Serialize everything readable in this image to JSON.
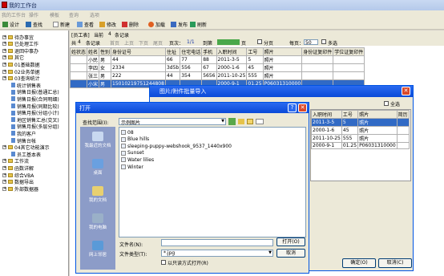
{
  "app": {
    "title": "我的工作台"
  },
  "menu": [
    "我的工作台",
    "操作",
    "模板",
    "查询",
    "选项"
  ],
  "toolbar": {
    "design": "设计",
    "search": "查找",
    "new": "新建",
    "view": "查看",
    "modify": "修改",
    "delete": "删除",
    "load": "加载",
    "publish": "发布",
    "refresh": "刷新"
  },
  "sidebar": {
    "items": [
      {
        "label": "待办事宜",
        "type": "folder"
      },
      {
        "label": "已处理工作",
        "type": "folder"
      },
      {
        "label": "退回中事办",
        "type": "folder"
      },
      {
        "label": "其它",
        "type": "folder"
      },
      {
        "label": "01基础数据",
        "type": "folder"
      },
      {
        "label": "02业务单据",
        "type": "folder"
      },
      {
        "label": "03查询统计",
        "type": "folder"
      },
      {
        "label": "统计销售表",
        "type": "leaf"
      },
      {
        "label": "销售日报(普通汇总)",
        "type": "leaf"
      },
      {
        "label": "销售日报(合同明细)",
        "type": "leaf"
      },
      {
        "label": "销售月报(同期比较)",
        "type": "leaf"
      },
      {
        "label": "销售月报(分组小计)",
        "type": "leaf"
      },
      {
        "label": "地区销售汇总(交叉)",
        "type": "leaf"
      },
      {
        "label": "销售月报(多层分组)",
        "type": "leaf"
      },
      {
        "label": "我的客户",
        "type": "leaf"
      },
      {
        "label": "销售台帐",
        "type": "leaf"
      },
      {
        "label": "04其它功能演示",
        "type": "folder"
      },
      {
        "label": "员工基本表",
        "type": "leaf"
      },
      {
        "label": "工作流",
        "type": "folder"
      },
      {
        "label": "函数详解",
        "type": "folder"
      },
      {
        "label": "综合VBA",
        "type": "folder"
      },
      {
        "label": "数据导出",
        "type": "folder"
      },
      {
        "label": "外部数据器",
        "type": "folder"
      }
    ]
  },
  "filter": {
    "employee": "[员工表]",
    "match": "当前",
    "count": "4",
    "records": "条记录"
  },
  "pager": {
    "total_label": "共",
    "total": "4",
    "unit": "条记录",
    "first": "首页",
    "prev": "上页",
    "next": "下页",
    "last": "尾页",
    "pages_label": "页次：",
    "pages": "1/1",
    "goto": "到第",
    "page_unit": "页",
    "paging": "分页",
    "per_page_label": "每页：",
    "per_page": "50",
    "multi": "多选"
  },
  "grid": {
    "columns": [
      "姓状态",
      "姓名",
      "性别",
      "身份证号",
      "住址",
      "住宅电话",
      "手机",
      "入职时间",
      "工号",
      "照片",
      "身份证复印件",
      "学位证复印件"
    ],
    "rows": [
      [
        "",
        "小民",
        "男",
        "44",
        "66",
        "77",
        "88",
        "2011-3-5",
        "5",
        "照片",
        "",
        ""
      ],
      [
        "",
        "李四",
        "女",
        "2334",
        "3d5b",
        "556",
        "67",
        "2000-1-6",
        "45",
        "照片",
        "",
        ""
      ],
      [
        "",
        "张三",
        "男",
        "222",
        "44",
        "354",
        "5656",
        "2011-10-25",
        "555",
        "照片",
        "",
        ""
      ],
      [
        "",
        "小宋",
        "男",
        "15010219751244808",
        "",
        "",
        "",
        "2000-9-1",
        "01.25",
        "P06031310000",
        "",
        ""
      ]
    ]
  },
  "import_window": {
    "title": "图片/附件批量导入",
    "select_all": "全选",
    "columns": [
      "入职时间",
      "工号",
      "照片",
      "简历"
    ],
    "rows": [
      [
        "2011-3-5",
        "5",
        "照片",
        ""
      ],
      [
        "2000-1-6",
        "45",
        "照片",
        ""
      ],
      [
        "2011-10-25",
        "555",
        "照片",
        ""
      ],
      [
        "2000-9-1",
        "01.25",
        "P06031310000",
        ""
      ]
    ],
    "ok": "确定(O)",
    "cancel": "取消(C)",
    "extra_col": "简历"
  },
  "open_dialog": {
    "title": "打开",
    "look_in_label": "查找范围(I):",
    "look_in_value": "示例图片",
    "places": [
      "我最近的文档",
      "桌面",
      "我的文档",
      "我的电脑",
      "网上邻居"
    ],
    "files": [
      "08",
      "Blue hills",
      "sleeping-puppy-webshook_9537_1440x900",
      "Sunset",
      "Water lilies",
      "Winter"
    ],
    "filename_label": "文件名(N):",
    "filename_value": "",
    "filetype_label": "文件类型(T):",
    "filetype_value": "*.jpg",
    "readonly_label": "以只读方式打开(R)",
    "open": "打开(O)",
    "cancel": "取消"
  }
}
